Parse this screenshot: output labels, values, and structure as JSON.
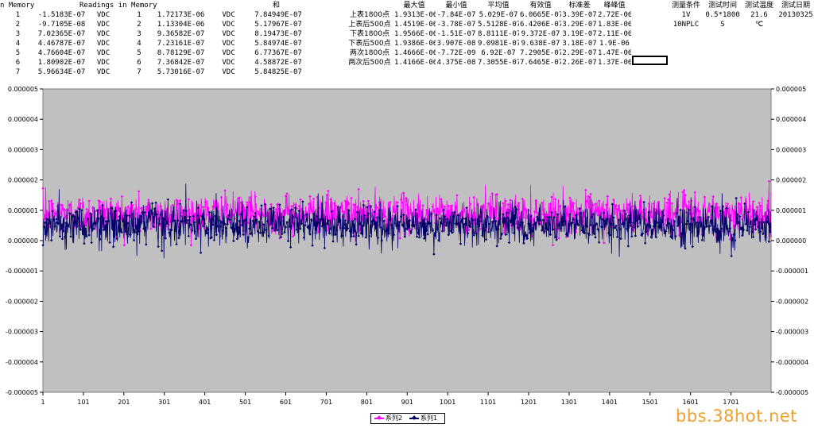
{
  "sheet": {
    "col_headers": {
      "memory": "n Memory",
      "readings": "Readings in Memory",
      "sum": "和",
      "max": "最大值",
      "min": "最小值",
      "avg": "平均值",
      "rms": "有效值",
      "std": "标准差",
      "pp": "峰峰值",
      "cond": "测量条件",
      "time": "测试时间",
      "temp": "测试温度",
      "date": "测试日期"
    },
    "rows": [
      {
        "idx": "1",
        "v1": "-1.5183E-07",
        "u1": "VDC",
        "n2": "1",
        "v2": "1.72173E-06",
        "u2": "VDC",
        "sum": "7.84949E-07"
      },
      {
        "idx": "2",
        "v1": "-9.7105E-08",
        "u1": "VDC",
        "n2": "2",
        "v2": "1.13304E-06",
        "u2": "VDC",
        "sum": "5.17967E-07"
      },
      {
        "idx": "3",
        "v1": "7.02365E-07",
        "u1": "VDC",
        "n2": "3",
        "v2": "9.36582E-07",
        "u2": "VDC",
        "sum": "8.19473E-07"
      },
      {
        "idx": "4",
        "v1": "4.46787E-07",
        "u1": "VDC",
        "n2": "4",
        "v2": "7.23161E-07",
        "u2": "VDC",
        "sum": "5.84974E-07"
      },
      {
        "idx": "5",
        "v1": "4.76604E-07",
        "u1": "VDC",
        "n2": "5",
        "v2": "8.78129E-07",
        "u2": "VDC",
        "sum": "6.77367E-07"
      },
      {
        "idx": "6",
        "v1": "1.80902E-07",
        "u1": "VDC",
        "n2": "6",
        "v2": "7.36842E-07",
        "u2": "VDC",
        "sum": "4.58872E-07"
      },
      {
        "idx": "7",
        "v1": "5.96634E-07",
        "u1": "VDC",
        "n2": "7",
        "v2": "5.73016E-07",
        "u2": "VDC",
        "sum": "5.84825E-07"
      }
    ],
    "stats": [
      {
        "label": "上表1800点",
        "max": "1.9313E-06",
        "min": "-7.84E-07",
        "avg": "5.029E-07",
        "rms": "6.0665E-07",
        "std": "3.39E-07",
        "pp": "2.72E-06"
      },
      {
        "label": "上表后500点",
        "max": "1.4519E-06",
        "min": "-3.78E-07",
        "avg": "5.5128E-07",
        "rms": "6.4206E-07",
        "std": "3.29E-07",
        "pp": "1.83E-06"
      },
      {
        "label": "下表1800点",
        "max": "1.9566E-06",
        "min": "-1.51E-07",
        "avg": "8.8111E-07",
        "rms": "9.372E-07",
        "std": "3.19E-07",
        "pp": "2.11E-06"
      },
      {
        "label": "下表后500点",
        "max": "1.9386E-06",
        "min": "3.907E-08",
        "avg": "9.0981E-07",
        "rms": "9.638E-07",
        "std": "3.18E-07",
        "pp": "1.9E-06"
      },
      {
        "label": "两次1800点",
        "max": "1.4666E-06",
        "min": "-7.72E-09",
        "avg": "6.92E-07",
        "rms": "7.2905E-07",
        "std": "2.29E-07",
        "pp": "1.47E-06"
      },
      {
        "label": "两次后500点",
        "max": "1.4166E-06",
        "min": "4.375E-08",
        "avg": "7.3055E-07",
        "rms": "7.6465E-07",
        "std": "2.26E-07",
        "pp": "1.37E-06"
      }
    ],
    "conditions": {
      "cond_1": "1V",
      "cond_2": "10NPLC",
      "time_1": "0.5*1800",
      "time_2": "S",
      "temp_1": "21.6",
      "temp_2": "℃",
      "date_1": "20130325"
    }
  },
  "chart_data": {
    "type": "line",
    "x_range": [
      1,
      1800
    ],
    "x_ticks": [
      "1",
      "101",
      "201",
      "301",
      "401",
      "501",
      "601",
      "701",
      "801",
      "901",
      "1001",
      "1101",
      "1201",
      "1301",
      "1401",
      "1501",
      "1601",
      "1701"
    ],
    "y_ticks": [
      "0.000005",
      "0.000004",
      "0.000003",
      "0.000002",
      "0.000001",
      "0.000000",
      "-0.000001",
      "-0.000002",
      "-0.000003",
      "-0.000004",
      "-0.000005"
    ],
    "ylim": [
      -5e-06,
      5e-06
    ],
    "plot_background": "#c0c0c0",
    "series": [
      {
        "name": "系列2",
        "color": "#ff00ff",
        "marker": "diamond",
        "mean": 8.8111e-07,
        "std": 3.19e-07,
        "min": -1.51e-07,
        "max": 1.9566e-06,
        "first_values": [
          1.72173e-06,
          1.13304e-06,
          9.36582e-07,
          7.23161e-07,
          8.78129e-07,
          7.36842e-07,
          5.73016e-07
        ]
      },
      {
        "name": "系列1",
        "color": "#000066",
        "marker": "diamond",
        "mean": 5.029e-07,
        "std": 3.39e-07,
        "min": -7.84e-07,
        "max": 1.9313e-06,
        "first_values": [
          -1.5183e-07,
          -9.7105e-08,
          7.02365e-07,
          4.46787e-07,
          4.76604e-07,
          1.80902e-07,
          5.96634e-07
        ]
      }
    ],
    "legend_position": "bottom-center"
  },
  "watermark": "bbs.38hot.net"
}
